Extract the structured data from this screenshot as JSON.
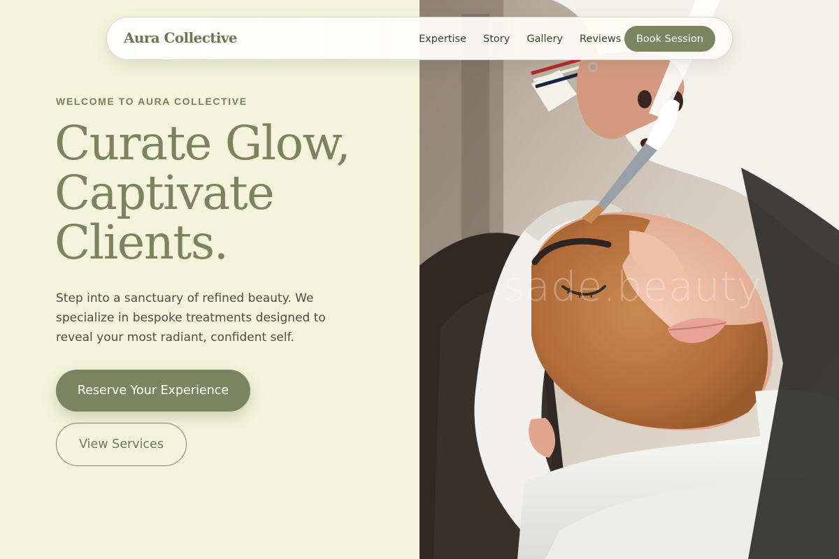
{
  "brand": {
    "name": "Aura Collective"
  },
  "nav": {
    "links": [
      "Expertise",
      "Story",
      "Gallery",
      "Reviews"
    ],
    "cta_label": "Book Session"
  },
  "hero": {
    "eyebrow": "WELCOME TO AURA COLLECTIVE",
    "headline_lines": [
      "Curate Glow,",
      "Captivate",
      "Clients."
    ],
    "description": "Step into a sanctuary of refined beauty. We specialize in bespoke treatments designed to reveal your most radiant, confident self.",
    "primary_cta": "Reserve Your Experience",
    "secondary_cta": "View Services"
  },
  "photo": {
    "watermark": "sade.beauty"
  },
  "colors": {
    "background": "#f4f4dc",
    "accent": "#7a8460",
    "headline": "#7c845f"
  }
}
